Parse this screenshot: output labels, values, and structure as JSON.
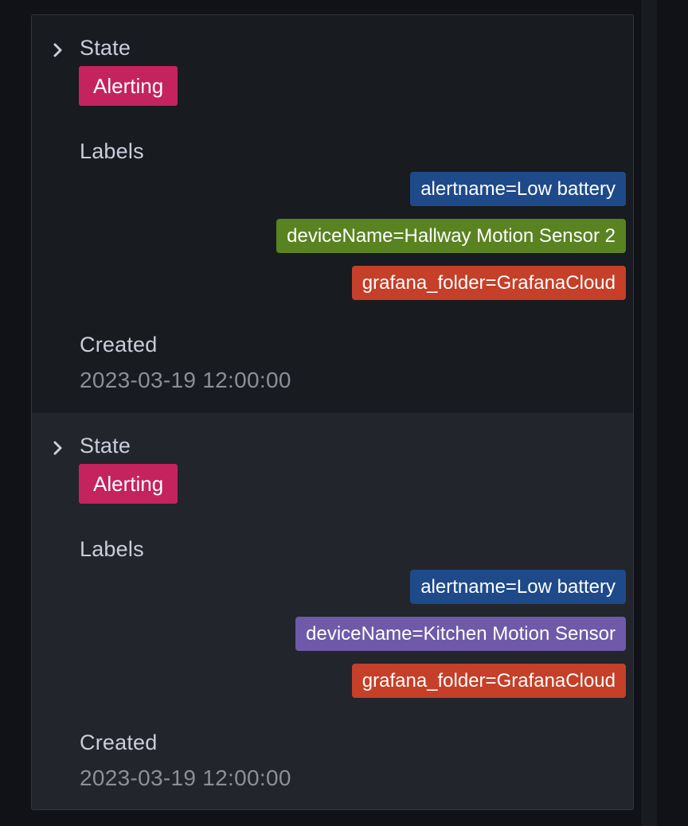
{
  "instances": [
    {
      "state_label": "State",
      "state_value": "Alerting",
      "labels_heading": "Labels",
      "labels": [
        {
          "text": "alertname=Low battery",
          "color": "#1f4a8a"
        },
        {
          "text": "deviceName=Hallway Motion Sensor 2",
          "color": "#598321"
        },
        {
          "text": "grafana_folder=GrafanaCloud",
          "color": "#c53f29"
        }
      ],
      "created_label": "Created",
      "created_value": "2023-03-19 12:00:00"
    },
    {
      "state_label": "State",
      "state_value": "Alerting",
      "labels_heading": "Labels",
      "labels": [
        {
          "text": "alertname=Low battery",
          "color": "#1f4a8a"
        },
        {
          "text": "deviceName=Kitchen Motion Sensor",
          "color": "#6e5aa8"
        },
        {
          "text": "grafana_folder=GrafanaCloud",
          "color": "#c53f29"
        }
      ],
      "created_label": "Created",
      "created_value": "2023-03-19 12:00:00"
    }
  ],
  "colors": {
    "alerting_badge": "#c4235e"
  },
  "icons": {
    "expand": "chevron-right-icon"
  }
}
